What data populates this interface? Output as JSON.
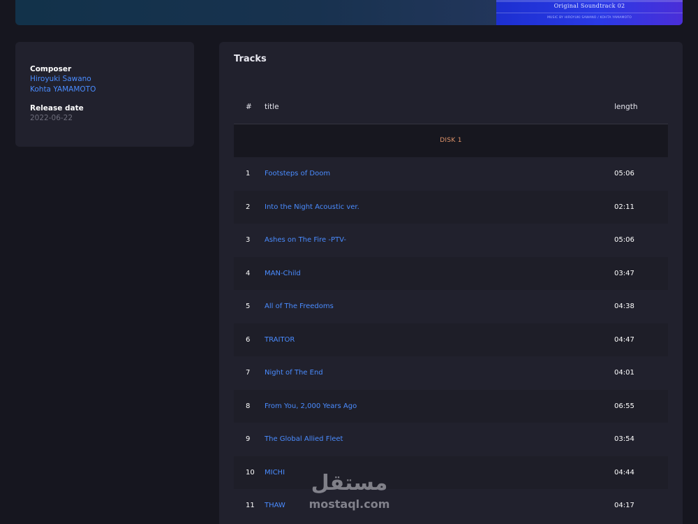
{
  "hero": {
    "cover_title": "Original Soundtrack 02",
    "cover_subtitle": "MUSIC BY HIROYUKI SAWANO / KOHTA YAMAMOTO"
  },
  "info": {
    "composer_label": "Composer",
    "composers": [
      "Hiroyuki Sawano",
      "Kohta YAMAMOTO"
    ],
    "release_label": "Release date",
    "release_date": "2022-06-22"
  },
  "tracks": {
    "title": "Tracks",
    "headers": {
      "num": "#",
      "title": "title",
      "length": "length"
    },
    "disk_label": "DISK 1",
    "rows": [
      {
        "num": "1",
        "title": "Footsteps of Doom",
        "length": "05:06"
      },
      {
        "num": "2",
        "title": "Into the Night Acoustic ver.",
        "length": "02:11"
      },
      {
        "num": "3",
        "title": "Ashes on The Fire -PTV-",
        "length": "05:06"
      },
      {
        "num": "4",
        "title": "MAN-Child",
        "length": "03:47"
      },
      {
        "num": "5",
        "title": "All of The Freedoms",
        "length": "04:38"
      },
      {
        "num": "6",
        "title": "TRAITOR",
        "length": "04:47"
      },
      {
        "num": "7",
        "title": "Night of The End",
        "length": "04:01"
      },
      {
        "num": "8",
        "title": "From You, 2,000 Years Ago",
        "length": "06:55"
      },
      {
        "num": "9",
        "title": "The Global Allied Fleet",
        "length": "03:54"
      },
      {
        "num": "10",
        "title": "MICHI",
        "length": "04:44"
      },
      {
        "num": "11",
        "title": "THAW",
        "length": "04:17"
      }
    ]
  },
  "watermark": {
    "arabic": "مستقل",
    "latin": "mostaql.com"
  },
  "colors": {
    "background": "#16161f",
    "card": "#21212d",
    "link": "#4a8cff",
    "disk": "#e2956b"
  }
}
